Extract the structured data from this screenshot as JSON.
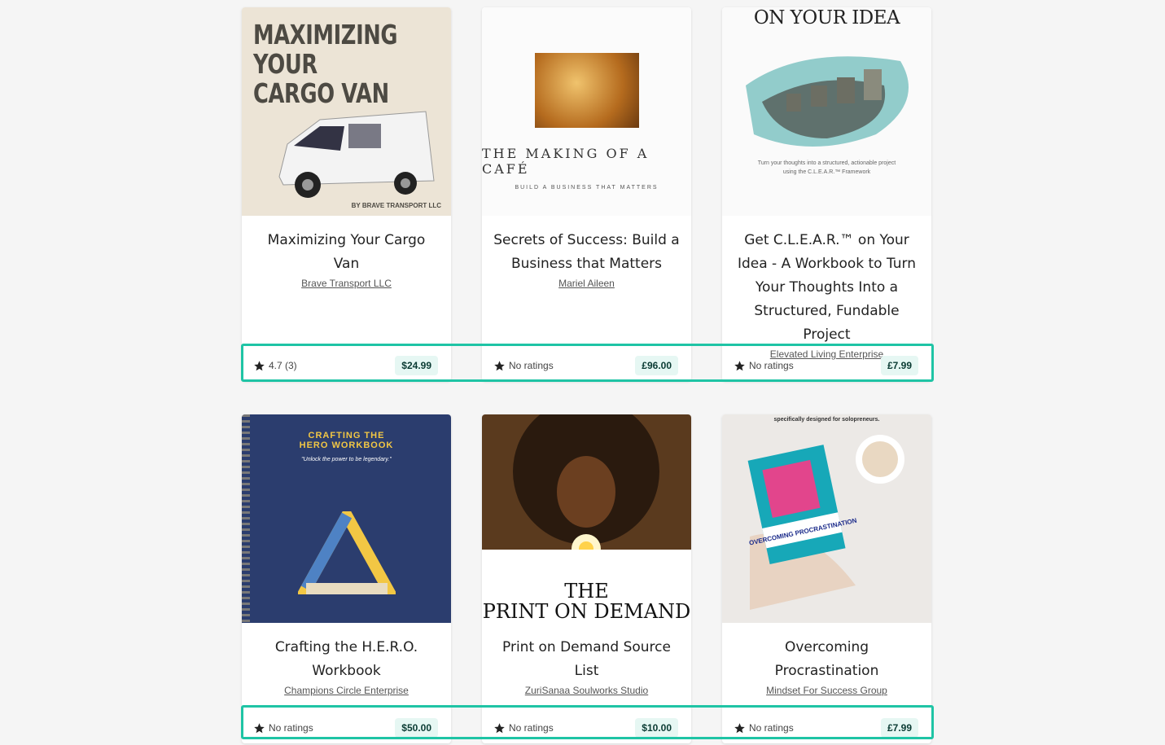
{
  "products": [
    {
      "title": "Maximizing Your Cargo Van",
      "author": "Brave Transport LLC",
      "rating": "4.7 (3)",
      "price": "$24.99",
      "cover": {
        "lines": [
          "MAXIMIZING",
          "YOUR",
          "CARGO VAN"
        ],
        "byline": "BY BRAVE TRANSPORT LLC"
      }
    },
    {
      "title": "Secrets of Success: Build a Business that Matters",
      "author": "Mariel Aileen",
      "rating": "No ratings",
      "price": "£96.00",
      "cover": {
        "title": "THE MAKING OF A CAFÉ",
        "subtitle": "BUILD A BUSINESS THAT MATTERS"
      }
    },
    {
      "title": "Get C.L.E.A.R.™ on Your Idea - A Workbook to Turn Your Thoughts Into a Structured, Fundable Project",
      "author": "Elevated Living Enterprise",
      "rating": "No ratings",
      "price": "£7.99",
      "cover": {
        "title": "ON YOUR IDEA",
        "subtitle": "Turn your thoughts into a structured, actionable project",
        "subtitle2": "using the C.L.E.A.R.™ Framework"
      }
    },
    {
      "title": "Crafting the H.E.R.O. Workbook",
      "author": "Champions Circle Enterprise",
      "rating": "No ratings",
      "price": "$50.00",
      "cover": {
        "title": "CRAFTING THE HERO WORKBOOK",
        "quote": "\"Unlock the power to be legendary.\""
      }
    },
    {
      "title": "Print on Demand Source List",
      "author": "ZuriSanaa Soulworks Studio",
      "rating": "No ratings",
      "price": "$10.00",
      "cover": {
        "line1": "THE",
        "line2": "PRINT ON DEMAND"
      }
    },
    {
      "title": "Overcoming Procrastination",
      "author": "Mindset For Success Group",
      "rating": "No ratings",
      "price": "£7.99",
      "cover": {
        "top": "specifically designed for solopreneurs.",
        "book": "OVERCOMING PROCRASTINATION"
      }
    }
  ],
  "colors": {
    "highlight": "#1fc4a5",
    "price_bg": "#e6f7f3",
    "price_text": "#0a3b33"
  },
  "icons": {
    "rating": "star-icon"
  }
}
